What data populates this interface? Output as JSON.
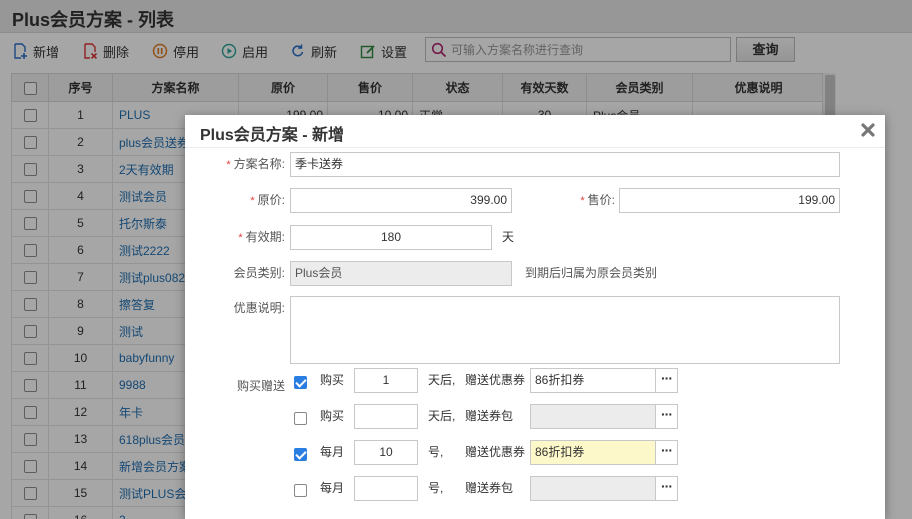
{
  "page": {
    "title": "Plus会员方案 - 列表"
  },
  "toolbar": {
    "add": "新增",
    "delete": "删除",
    "disable": "停用",
    "enable": "启用",
    "refresh": "刷新",
    "settings": "设置",
    "search_placeholder": "可输入方案名称进行查询",
    "query": "查询"
  },
  "grid": {
    "headers": [
      "序号",
      "方案名称",
      "原价",
      "售价",
      "状态",
      "有效天数",
      "会员类别",
      "优惠说明"
    ],
    "rows": [
      {
        "no": "1",
        "name": "PLUS",
        "orig": "199.00",
        "sale": "10.00",
        "status": "正常",
        "days": "30",
        "type": "Plus会员",
        "desc": ""
      },
      {
        "no": "2",
        "name": "plus会员送券",
        "orig": "",
        "sale": "",
        "status": "",
        "days": "",
        "type": "",
        "desc": ""
      },
      {
        "no": "3",
        "name": "2天有效期",
        "orig": "",
        "sale": "",
        "status": "",
        "days": "",
        "type": "",
        "desc": ""
      },
      {
        "no": "4",
        "name": "测试会员",
        "orig": "",
        "sale": "",
        "status": "",
        "days": "",
        "type": "",
        "desc": ""
      },
      {
        "no": "5",
        "name": "托尔斯泰",
        "orig": "",
        "sale": "",
        "status": "",
        "days": "",
        "type": "",
        "desc": ""
      },
      {
        "no": "6",
        "name": "测试2222",
        "orig": "",
        "sale": "",
        "status": "",
        "days": "",
        "type": "",
        "desc": ""
      },
      {
        "no": "7",
        "name": "测试plus082",
        "orig": "",
        "sale": "",
        "status": "",
        "days": "",
        "type": "",
        "desc": ""
      },
      {
        "no": "8",
        "name": "擦答复",
        "orig": "",
        "sale": "",
        "status": "",
        "days": "",
        "type": "",
        "desc": ""
      },
      {
        "no": "9",
        "name": "测试",
        "orig": "",
        "sale": "",
        "status": "",
        "days": "",
        "type": "",
        "desc": ""
      },
      {
        "no": "10",
        "name": "babyfunny",
        "orig": "",
        "sale": "",
        "status": "",
        "days": "",
        "type": "",
        "desc": ""
      },
      {
        "no": "11",
        "name": "9988",
        "orig": "",
        "sale": "",
        "status": "",
        "days": "",
        "type": "",
        "desc": ""
      },
      {
        "no": "12",
        "name": "年卡",
        "orig": "",
        "sale": "",
        "status": "",
        "days": "",
        "type": "",
        "desc": ""
      },
      {
        "no": "13",
        "name": "618plus会员",
        "orig": "",
        "sale": "",
        "status": "",
        "days": "",
        "type": "",
        "desc": ""
      },
      {
        "no": "14",
        "name": "新增会员方案",
        "orig": "",
        "sale": "",
        "status": "",
        "days": "",
        "type": "",
        "desc": ""
      },
      {
        "no": "15",
        "name": "测试PLUS会员",
        "orig": "",
        "sale": "",
        "status": "",
        "days": "",
        "type": "",
        "desc": ""
      },
      {
        "no": "16",
        "name": "2",
        "orig": "",
        "sale": "",
        "status": "",
        "days": "",
        "type": "",
        "desc": ""
      }
    ]
  },
  "dialog": {
    "title": "Plus会员方案 - 新增",
    "name_label": "方案名称:",
    "name_value": "季卡送券",
    "orig_label": "原价:",
    "orig_value": "399.00",
    "sale_label": "售价:",
    "sale_value": "199.00",
    "valid_label": "有效期:",
    "valid_value": "180",
    "valid_unit": "天",
    "type_label": "会员类别:",
    "type_value": "Plus会员",
    "type_note": "到期后归属为原会员类别",
    "desc_label": "优惠说明:",
    "desc_value": "",
    "gift_label": "购买赠送",
    "gift_rows": [
      {
        "checked": true,
        "prefix": "购买",
        "qty": "1",
        "unit": "天后,",
        "kind": "赠送优惠券",
        "value": "86折扣券",
        "disabled": false,
        "highlight": false
      },
      {
        "checked": false,
        "prefix": "购买",
        "qty": "",
        "unit": "天后,",
        "kind": "赠送券包",
        "value": "",
        "disabled": true,
        "highlight": false
      },
      {
        "checked": true,
        "prefix": "每月",
        "qty": "10",
        "unit": "号,",
        "kind": "赠送优惠券",
        "value": "86折扣券",
        "disabled": false,
        "highlight": true
      },
      {
        "checked": false,
        "prefix": "每月",
        "qty": "",
        "unit": "号,",
        "kind": "赠送券包",
        "value": "",
        "disabled": true,
        "highlight": false
      }
    ],
    "ellipsis": "···"
  }
}
